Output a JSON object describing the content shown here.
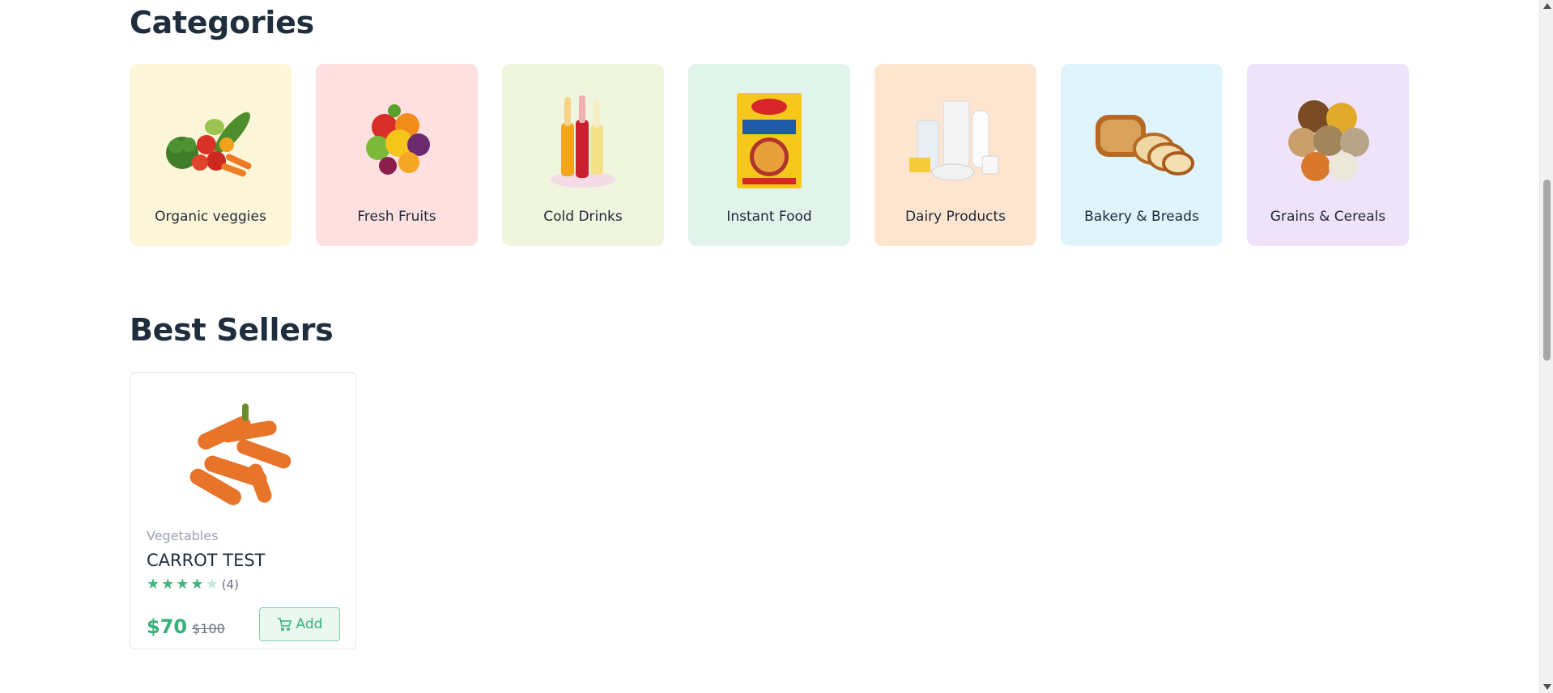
{
  "sections": {
    "categories_title": "Categories",
    "best_sellers_title": "Best Sellers"
  },
  "categories": [
    {
      "label": "Organic veggies",
      "bg": "#fef6d9",
      "icon": "vegetables-image"
    },
    {
      "label": "Fresh Fruits",
      "bg": "#fee0e1",
      "icon": "fruits-image"
    },
    {
      "label": "Cold Drinks",
      "bg": "#f0f5de",
      "icon": "bottles-image"
    },
    {
      "label": "Instant Food",
      "bg": "#e0f4ec",
      "icon": "noodle-pack-image"
    },
    {
      "label": "Dairy Products",
      "bg": "#fee5cf",
      "icon": "dairy-image"
    },
    {
      "label": "Bakery & Breads",
      "bg": "#e0f4fd",
      "icon": "bread-image"
    },
    {
      "label": "Grains & Cereals",
      "bg": "#efe3fa",
      "icon": "grains-image"
    }
  ],
  "product": {
    "category": "Vegetables",
    "name": "CARROT TEST",
    "rating": 4,
    "rating_count": "(4)",
    "price": "$70",
    "old_price": "$100",
    "add_label": "Add",
    "icon": "cart-icon"
  },
  "colors": {
    "accent": "#38b07a",
    "heading": "#1f2d3d"
  }
}
